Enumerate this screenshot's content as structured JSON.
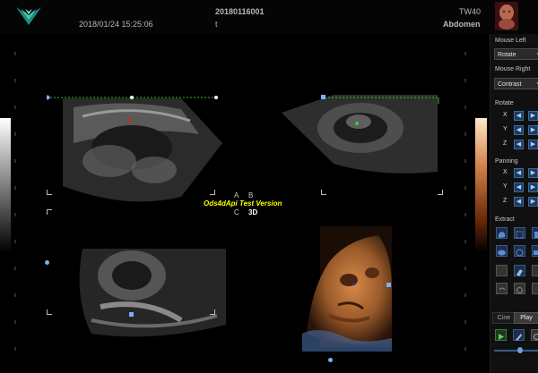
{
  "header": {
    "patient_id": "20180116001",
    "datetime": "2018/01/24 15:25:06",
    "patient_name": "t",
    "gestation": "TW40",
    "exam_type": "Abdomen"
  },
  "viewport": {
    "quadrant_labels": {
      "a": "A",
      "b": "B",
      "c": "C",
      "d": "3D"
    },
    "watermark": "Ods4dApi Test Version"
  },
  "panel": {
    "mouse_left_label": "Mouse Left",
    "mouse_left_value": "Rotate",
    "mouse_right_label": "Mouse Right",
    "mouse_right_value": "Contrast",
    "rotate_label": "Rotate",
    "panning_label": "Panning",
    "extract_label": "Extract",
    "axes": [
      "X",
      "Y",
      "Z"
    ],
    "tabs": {
      "cine": "Cine",
      "play": "Play"
    }
  },
  "colors": {
    "accent": "#6aa0e0",
    "logo": "#2aa89a",
    "watermark": "#ffff00",
    "marker_red": "#c02020",
    "marker_green": "#22a83c",
    "marker_blue": "#2030b8"
  }
}
